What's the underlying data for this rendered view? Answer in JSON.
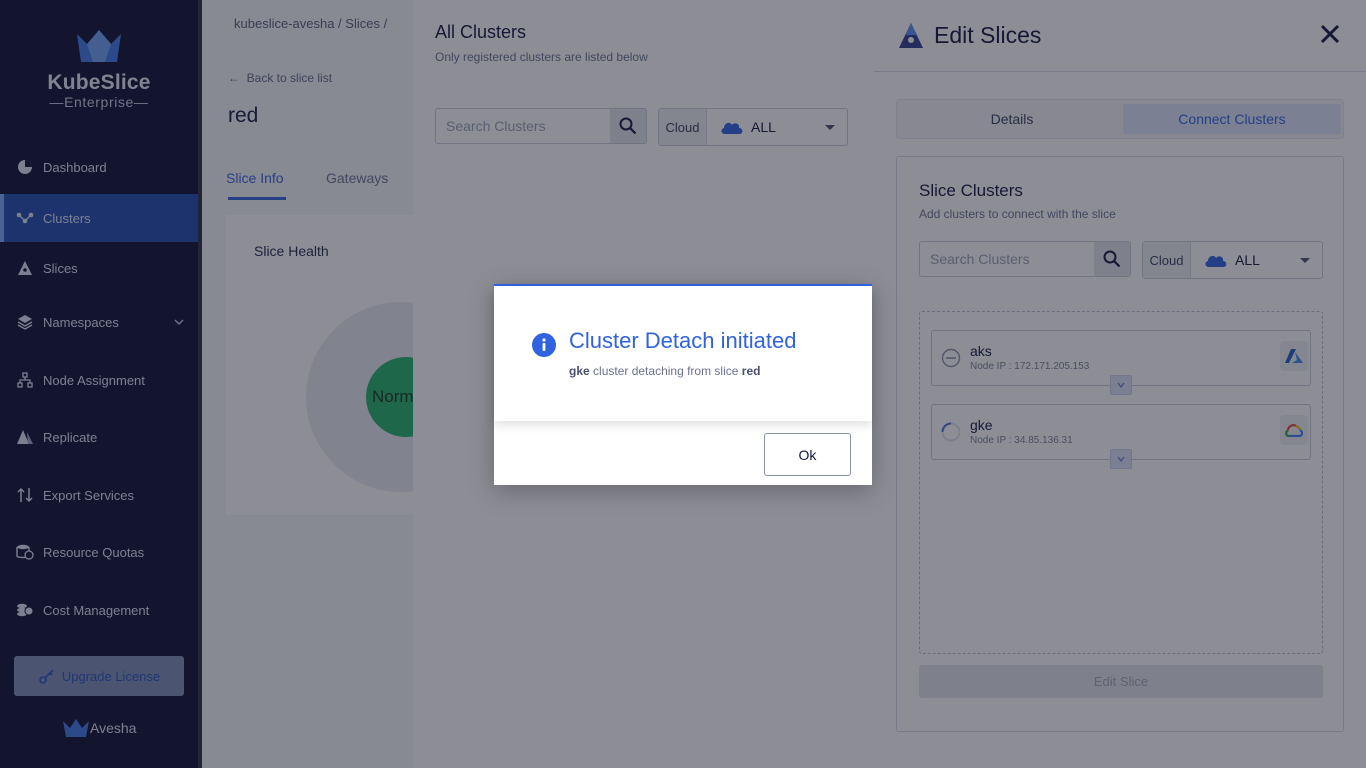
{
  "sidebar": {
    "logo": {
      "title": "KubeSlice",
      "subtitle": "Enterprise"
    },
    "items": [
      {
        "label": "Dashboard",
        "icon": "pie-chart-icon"
      },
      {
        "label": "Clusters",
        "icon": "clusters-icon",
        "active": true
      },
      {
        "label": "Slices",
        "icon": "slices-icon"
      },
      {
        "label": "Namespaces",
        "icon": "layers-icon",
        "has_chevron": true
      },
      {
        "label": "Node Assignment",
        "icon": "hierarchy-icon"
      },
      {
        "label": "Replicate",
        "icon": "replicate-icon"
      },
      {
        "label": "Export Services",
        "icon": "arrows-updown-icon"
      },
      {
        "label": "Resource Quotas",
        "icon": "database-clock-icon"
      },
      {
        "label": "Cost Management",
        "icon": "coins-icon"
      }
    ],
    "upgrade_label": "Upgrade License",
    "footer_brand": "Avesha"
  },
  "main": {
    "breadcrumb": "kubeslice-avesha / Slices /",
    "back_link": "Back to slice list",
    "slice_name": "red",
    "tabs": [
      "Slice Info",
      "Gateways"
    ],
    "slice_health_label": "Slice Health",
    "donut_label": "Norm"
  },
  "all_clusters": {
    "title": "All Clusters",
    "subtitle": "Only registered clusters are listed below",
    "search_placeholder": "Search Clusters",
    "cloud_label": "Cloud",
    "cloud_value": "ALL"
  },
  "edit_slices": {
    "title": "Edit Slices",
    "tabs": {
      "details": "Details",
      "connect": "Connect Clusters"
    },
    "card_title": "Slice Clusters",
    "card_subtitle": "Add clusters to connect with the slice",
    "search_placeholder": "Search Clusters",
    "cloud_label": "Cloud",
    "cloud_value": "ALL",
    "clusters": [
      {
        "name": "aks",
        "ip": "Node IP : 172.171.205.153",
        "status": "remove",
        "provider": "azure-icon"
      },
      {
        "name": "gke",
        "ip": "Node IP : 34.85.136.31",
        "status": "loading",
        "provider": "google-cloud-icon"
      }
    ],
    "edit_button": "Edit Slice"
  },
  "dialog": {
    "title": "Cluster Detach initiated",
    "message_cluster": "gke",
    "message_mid": "cluster detaching from slice",
    "message_slice": "red",
    "ok_label": "Ok"
  },
  "colors": {
    "sidebar_bg": "#0a0e2e",
    "active_nav": "#1f4bb0",
    "accent": "#2f63e0",
    "overlay": "rgba(25,28,44,0.5)"
  }
}
